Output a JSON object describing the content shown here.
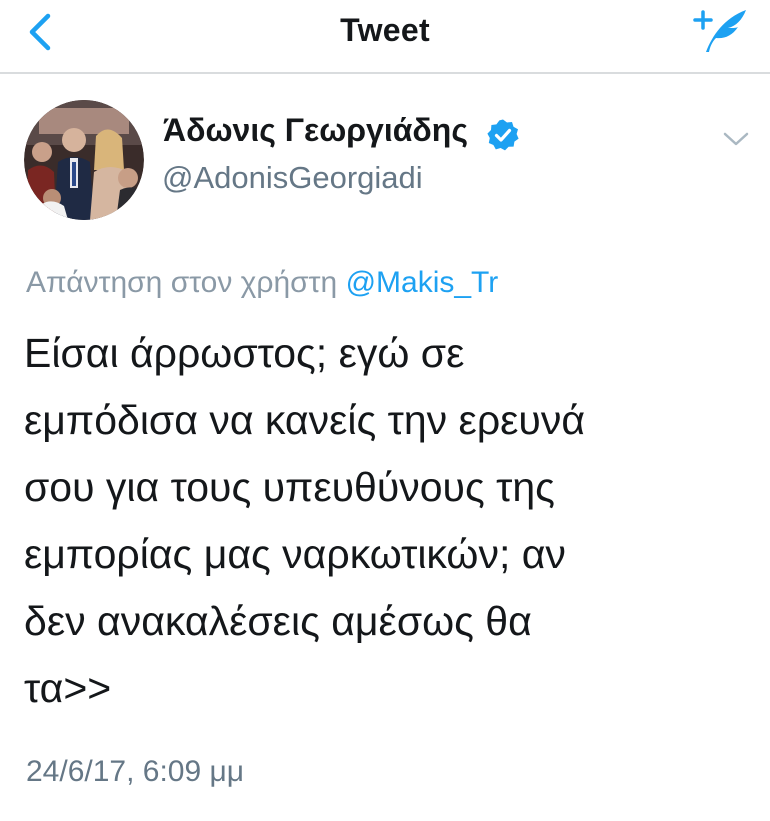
{
  "header": {
    "title": "Tweet",
    "back_icon": "chevron-left-icon",
    "compose_icon": "compose-tweet-icon"
  },
  "author": {
    "display_name": "Άδωνις Γεωργιάδης",
    "handle": "@AdonisGeorgiadi",
    "verified_icon": "verified-badge-icon"
  },
  "tweet": {
    "reply_prefix": "Απάντηση στον χρήστη",
    "reply_mention": "@Makis_Tr",
    "text": "Είσαι άρρωστος; εγώ σε\nεμπόδισα να κανείς την ερευνά\nσου για τους υπευθύνους της\nεμπορίας μας ναρκωτικών; αν\nδεν ανακαλέσεις αμέσως θα\nτα>>",
    "timestamp": "24/6/17, 6:09 μμ"
  },
  "colors": {
    "accent": "#1da1f2",
    "text": "#14171a",
    "secondary": "#657786",
    "divider": "#d9dcde"
  }
}
